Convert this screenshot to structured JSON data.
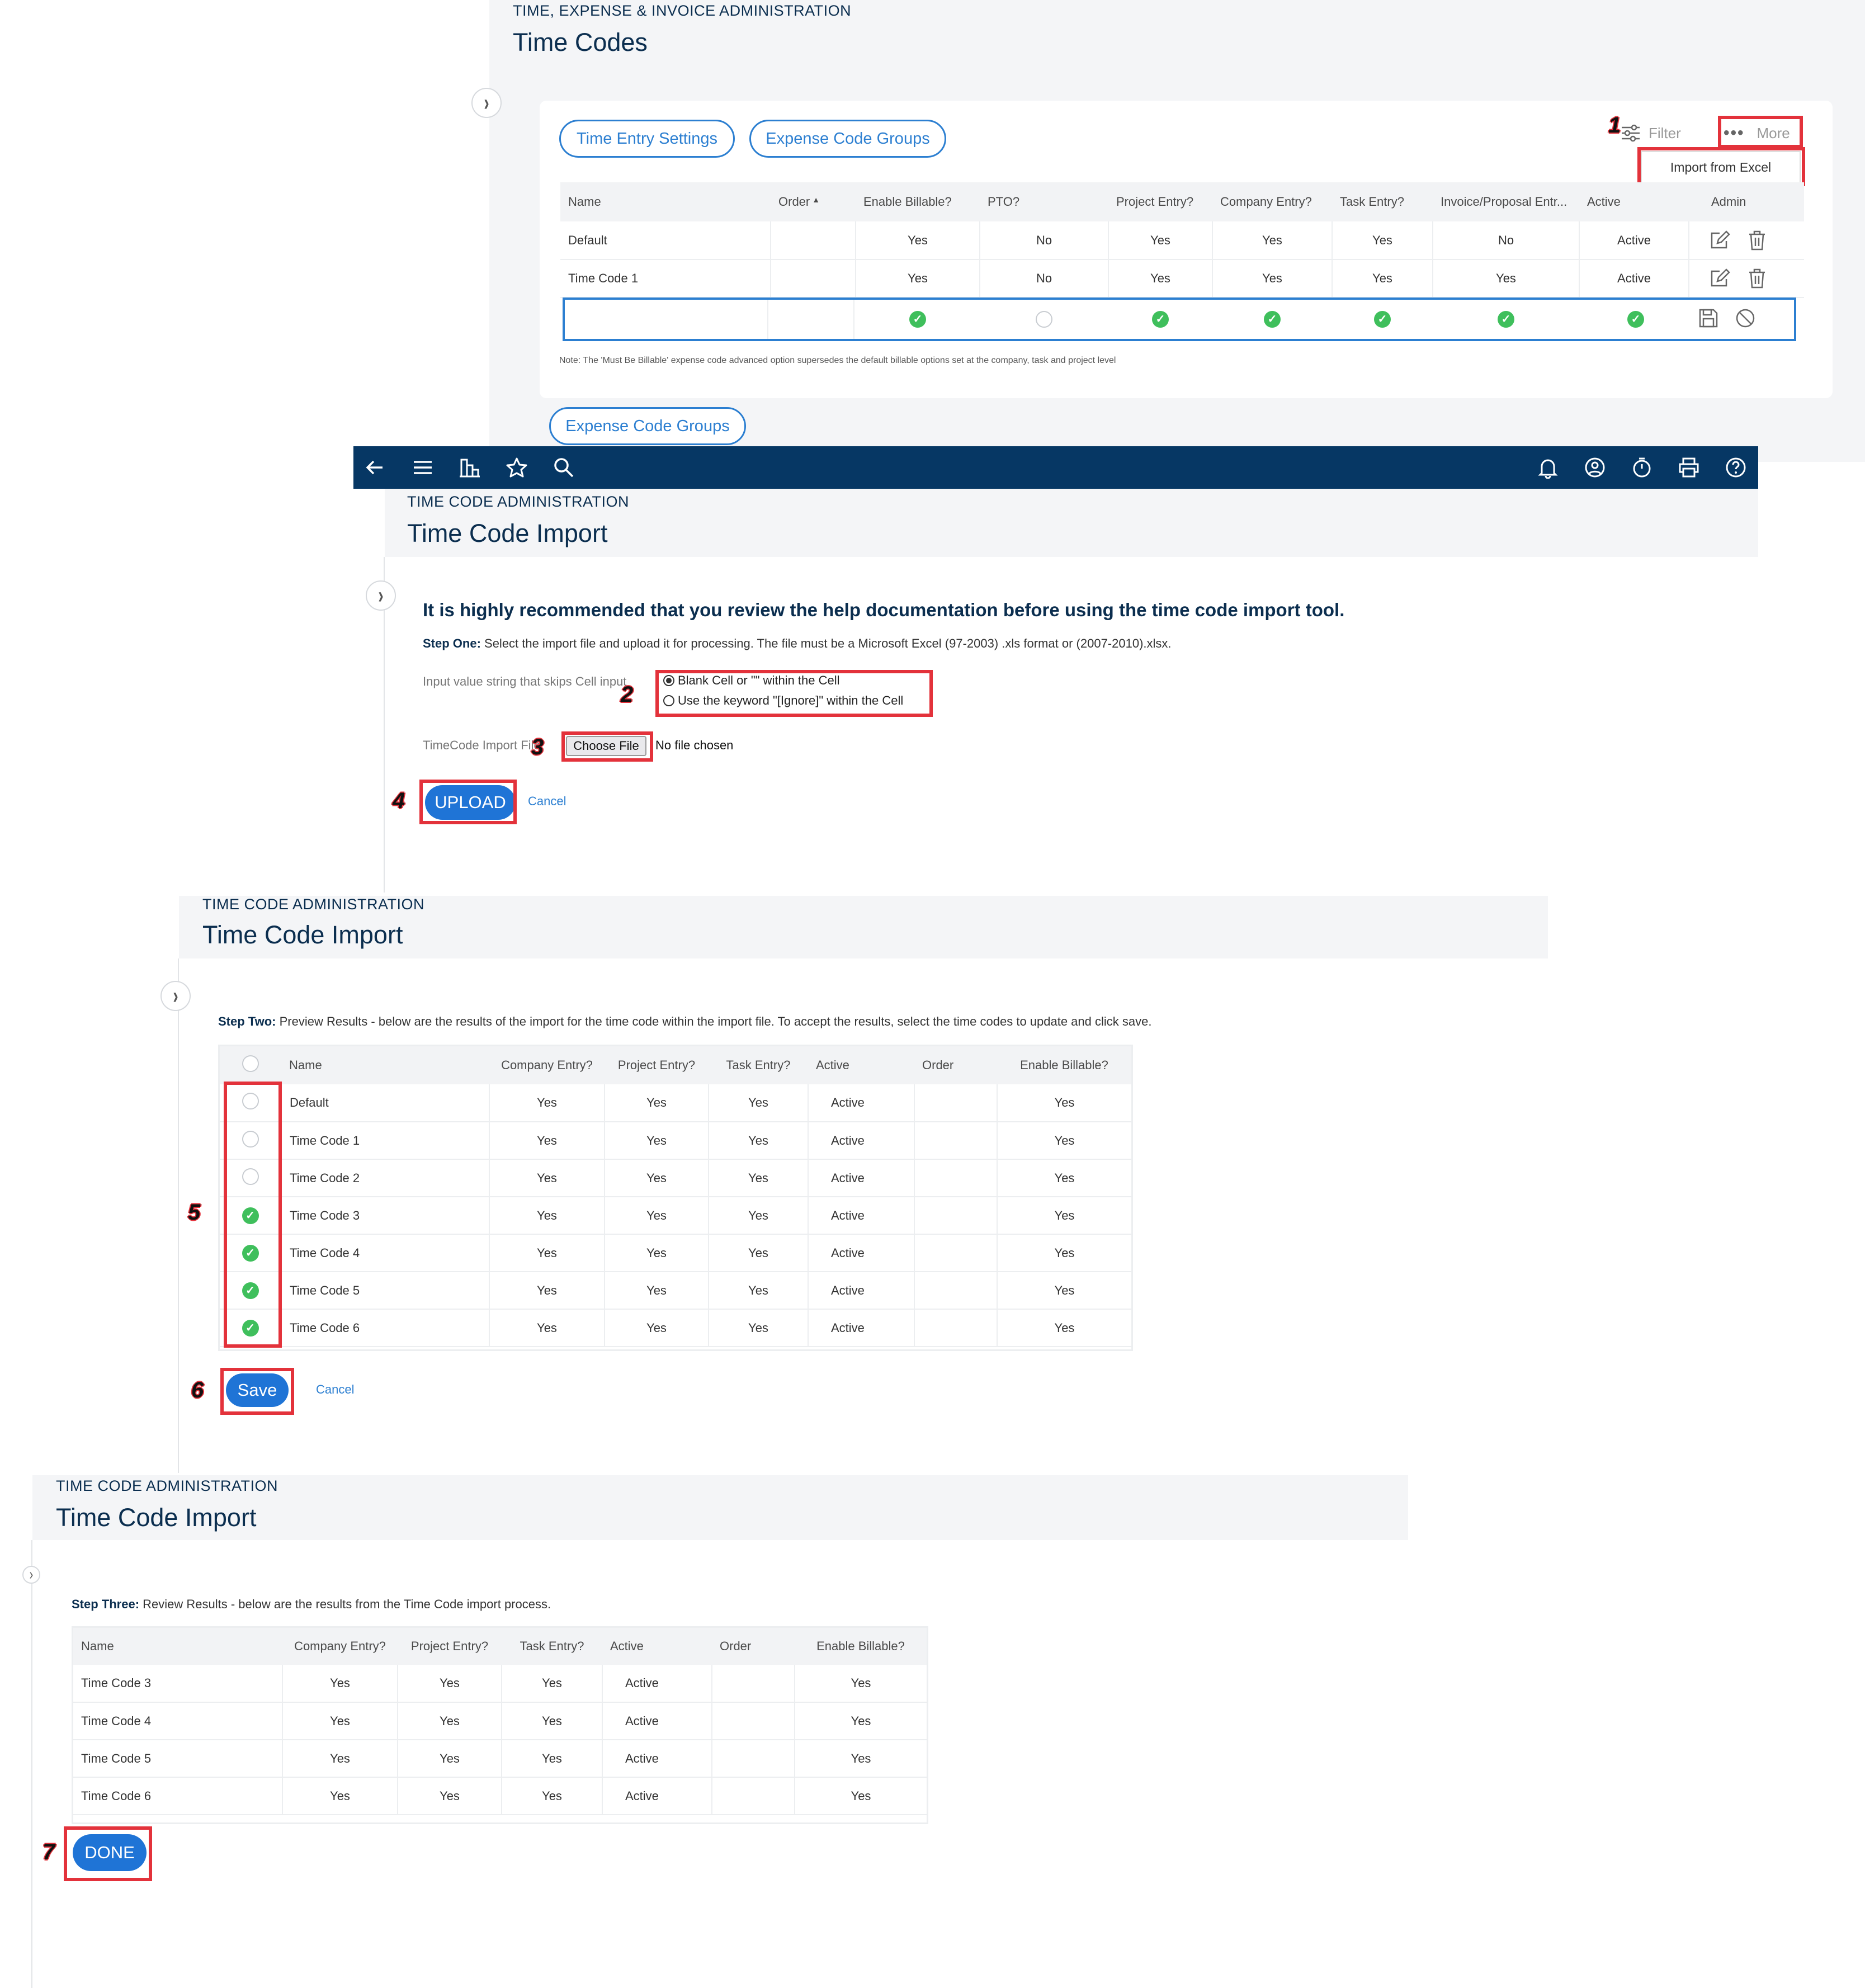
{
  "section1": {
    "breadcrumb": "TIME, EXPENSE & INVOICE ADMINISTRATION",
    "title": "Time Codes",
    "tab_time_entry_settings": "Time Entry Settings",
    "tab_expense_code_groups": "Expense Code Groups",
    "filter_label": "Filter",
    "more_label": "More",
    "more_menu_item": "Import from Excel",
    "columns": [
      "Name",
      "Order",
      "Enable Billable?",
      "PTO?",
      "Project Entry?",
      "Company Entry?",
      "Task Entry?",
      "Invoice/Proposal Entr...",
      "Active",
      "Admin"
    ],
    "rows": [
      [
        "Default",
        "",
        "Yes",
        "No",
        "Yes",
        "Yes",
        "Yes",
        "No",
        "Active"
      ],
      [
        "Time Code 1",
        "",
        "Yes",
        "No",
        "Yes",
        "Yes",
        "Yes",
        "Yes",
        "Active"
      ]
    ],
    "note": "Note: The 'Must Be Billable' expense code advanced option supersedes the default billable options set at the company, task and project level",
    "lower_tab": "Expense Code Groups"
  },
  "section2": {
    "breadcrumb": "TIME CODE ADMINISTRATION",
    "title": "Time Code Import",
    "headline": "It is highly recommended that you review the help documentation before using the time code import tool.",
    "step_label": "Step One:",
    "step_text": " Select the import file and upload it for processing. The file must be a Microsoft Excel (97-2003) .xls format or (2007-2010).xlsx.",
    "skip_label": "Input value string that skips Cell input",
    "radio_option_1": "Blank Cell or \"\" within the Cell",
    "radio_option_2": "Use the keyword \"[Ignore]\" within the Cell",
    "file_label": "TimeCode Import File",
    "choose_file": "Choose File",
    "no_file": "No file chosen",
    "upload": "UPLOAD",
    "cancel": "Cancel"
  },
  "section3": {
    "breadcrumb": "TIME CODE ADMINISTRATION",
    "title": "Time Code Import",
    "step_label": "Step Two:",
    "step_text": " Preview Results - below are the results of the import for the time code within the import file. To accept the results, select the time codes to update and click save.",
    "columns": [
      "Name",
      "Company Entry?",
      "Project Entry?",
      "Task Entry?",
      "Active",
      "Order",
      "Enable Billable?"
    ],
    "rows": [
      {
        "checked": false,
        "cells": [
          "Default",
          "Yes",
          "Yes",
          "Yes",
          "Active",
          "",
          "Yes"
        ]
      },
      {
        "checked": false,
        "cells": [
          "Time Code 1",
          "Yes",
          "Yes",
          "Yes",
          "Active",
          "",
          "Yes"
        ]
      },
      {
        "checked": false,
        "cells": [
          "Time Code 2",
          "Yes",
          "Yes",
          "Yes",
          "Active",
          "",
          "Yes"
        ]
      },
      {
        "checked": true,
        "cells": [
          "Time Code 3",
          "Yes",
          "Yes",
          "Yes",
          "Active",
          "",
          "Yes"
        ]
      },
      {
        "checked": true,
        "cells": [
          "Time Code 4",
          "Yes",
          "Yes",
          "Yes",
          "Active",
          "",
          "Yes"
        ]
      },
      {
        "checked": true,
        "cells": [
          "Time Code 5",
          "Yes",
          "Yes",
          "Yes",
          "Active",
          "",
          "Yes"
        ]
      },
      {
        "checked": true,
        "cells": [
          "Time Code 6",
          "Yes",
          "Yes",
          "Yes",
          "Active",
          "",
          "Yes"
        ]
      }
    ],
    "save": "Save",
    "cancel": "Cancel"
  },
  "section4": {
    "breadcrumb": "TIME CODE ADMINISTRATION",
    "title": "Time Code Import",
    "step_label": "Step Three:",
    "step_text": " Review Results - below are the results from the Time Code import process.",
    "columns": [
      "Name",
      "Company Entry?",
      "Project Entry?",
      "Task Entry?",
      "Active",
      "Order",
      "Enable Billable?"
    ],
    "rows": [
      [
        "Time Code 3",
        "Yes",
        "Yes",
        "Yes",
        "Active",
        "",
        "Yes"
      ],
      [
        "Time Code 4",
        "Yes",
        "Yes",
        "Yes",
        "Active",
        "",
        "Yes"
      ],
      [
        "Time Code 5",
        "Yes",
        "Yes",
        "Yes",
        "Active",
        "",
        "Yes"
      ],
      [
        "Time Code 6",
        "Yes",
        "Yes",
        "Yes",
        "Active",
        "",
        "Yes"
      ]
    ],
    "done": "DONE"
  },
  "step_numbers": [
    "1",
    "2",
    "3",
    "4",
    "5",
    "6",
    "7"
  ],
  "navbar_icons": [
    "back-arrow-icon",
    "menu-icon",
    "org-chart-icon",
    "star-icon",
    "search-icon",
    "bell-icon",
    "user-icon",
    "timer-icon",
    "printer-icon",
    "help-icon"
  ],
  "colors": {
    "navbar": "#063764",
    "accent": "#2c7fd1",
    "button": "#1f74d6",
    "highlight": "#e3323b",
    "check": "#3fbf5c"
  }
}
